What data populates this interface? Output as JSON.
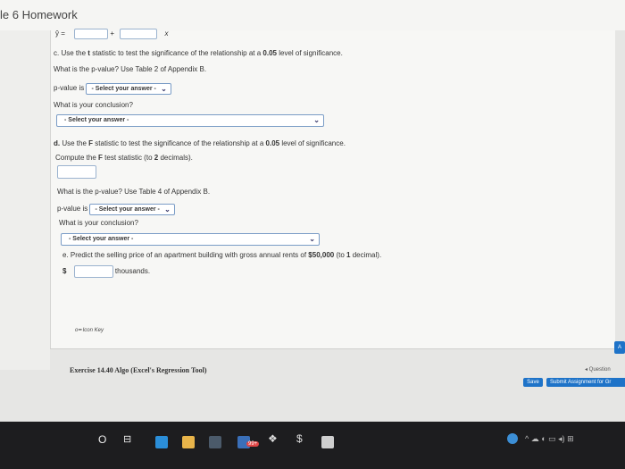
{
  "header": {
    "title": "le 6 Homework"
  },
  "equation": {
    "lhs": "ŷ =",
    "op": "+",
    "var": "x"
  },
  "part_c": {
    "prompt_letter": "c.",
    "prompt_a": "Use the",
    "stat": "t",
    "prompt_b": "statistic to test the significance of the relationship at a",
    "alpha": "0.05",
    "prompt_c": "level of significance.",
    "pvalue_question": "What is the p-value? Use Table 2 of Appendix B.",
    "pvalue_label": "p-value is",
    "pvalue_select": "- Select your answer -",
    "conclusion_question": "What is your conclusion?",
    "conclusion_select": "- Select your answer -"
  },
  "part_d": {
    "prompt_letter": "d.",
    "prompt_a": "Use the",
    "stat": "F",
    "prompt_b": "statistic to test the significance of the relationship at a",
    "alpha": "0.05",
    "prompt_c": "level of significance.",
    "compute_a": "Compute the",
    "compute_stat": "F",
    "compute_b": "test statistic (to",
    "compute_decimals": "2",
    "compute_c": "decimals).",
    "pvalue_question": "What is the p-value? Use Table 4 of Appendix B.",
    "pvalue_label": "p-value is",
    "pvalue_select": "- Select your answer -",
    "conclusion_question": "What is your conclusion?",
    "conclusion_select": "- Select your answer -"
  },
  "part_e": {
    "prompt_letter": "e.",
    "prompt_a": "Predict the selling price of an apartment building with gross annual rents of",
    "amount": "$50,000",
    "prompt_b": "(to",
    "decimals": "1",
    "prompt_c": "decimal).",
    "currency": "$",
    "unit": "thousands."
  },
  "icon_key": {
    "label": "Icon Key"
  },
  "footer": {
    "exercise": "Exercise 14.40 Algo (Excel's Regression Tool)",
    "question_nav": "◂ Question ",
    "save": "Save",
    "submit": "Submit Assignment for Gr",
    "side_tab": "A"
  },
  "taskbar": {
    "mail_badge": "99+"
  },
  "colors": {
    "accent": "#1e73c8",
    "taskbar": "#1d1d1f"
  }
}
